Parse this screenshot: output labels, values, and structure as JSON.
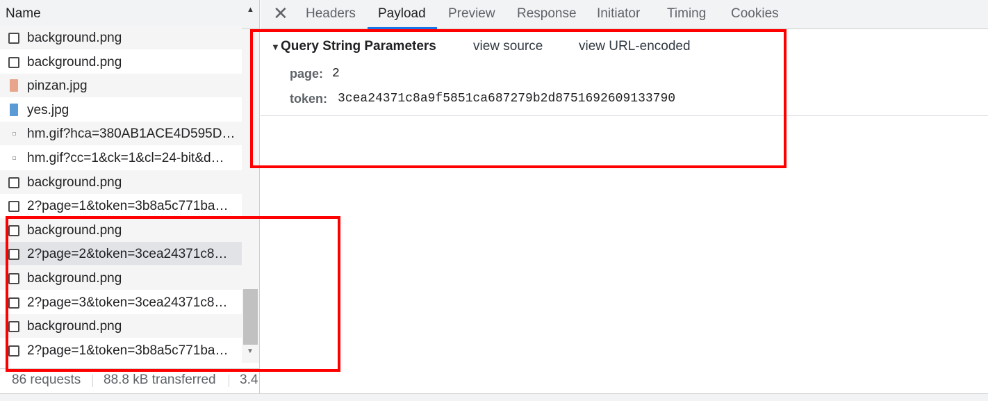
{
  "name_header": {
    "label": "Name"
  },
  "requests": [
    {
      "name": "background.png",
      "icon": "document-icon"
    },
    {
      "name": "background.png",
      "icon": "document-icon"
    },
    {
      "name": "pinzan.jpg",
      "icon": "image-file-icon"
    },
    {
      "name": "yes.jpg",
      "icon": "image-file-icon"
    },
    {
      "name": "hm.gif?hca=380AB1ACE4D595D…",
      "icon": "gif-icon"
    },
    {
      "name": "hm.gif?cc=1&ck=1&cl=24-bit&d…",
      "icon": "gif-icon"
    },
    {
      "name": "background.png",
      "icon": "document-icon"
    },
    {
      "name": "2?page=1&token=3b8a5c771ba…",
      "icon": "document-icon"
    },
    {
      "name": "background.png",
      "icon": "document-icon"
    },
    {
      "name": "2?page=2&token=3cea24371c8…",
      "icon": "document-icon",
      "selected": true
    },
    {
      "name": "background.png",
      "icon": "document-icon"
    },
    {
      "name": "2?page=3&token=3cea24371c8…",
      "icon": "document-icon"
    },
    {
      "name": "background.png",
      "icon": "document-icon"
    },
    {
      "name": "2?page=1&token=3b8a5c771ba…",
      "icon": "document-icon"
    }
  ],
  "status_bar": {
    "requests": "86 requests",
    "transferred": "88.8 kB transferred",
    "resources": "3.4"
  },
  "tabs": [
    {
      "label": "Headers",
      "active": false
    },
    {
      "label": "Payload",
      "active": true
    },
    {
      "label": "Preview",
      "active": false
    },
    {
      "label": "Response",
      "active": false
    },
    {
      "label": "Initiator",
      "active": false
    },
    {
      "label": "Timing",
      "active": false
    },
    {
      "label": "Cookies",
      "active": false
    }
  ],
  "payload": {
    "section_title": "Query String Parameters",
    "view_source": "view source",
    "view_url_encoded": "view URL-encoded",
    "params": [
      {
        "key": "page:",
        "value": "2"
      },
      {
        "key": "token:",
        "value": "3cea24371c8a9f5851ca687279b2d8751692609133790"
      }
    ]
  },
  "colors": {
    "accent": "#1a73e8",
    "annotation": "#ff0000",
    "selected_row": "#e1e3e6",
    "striped_row": "#f5f5f5"
  }
}
